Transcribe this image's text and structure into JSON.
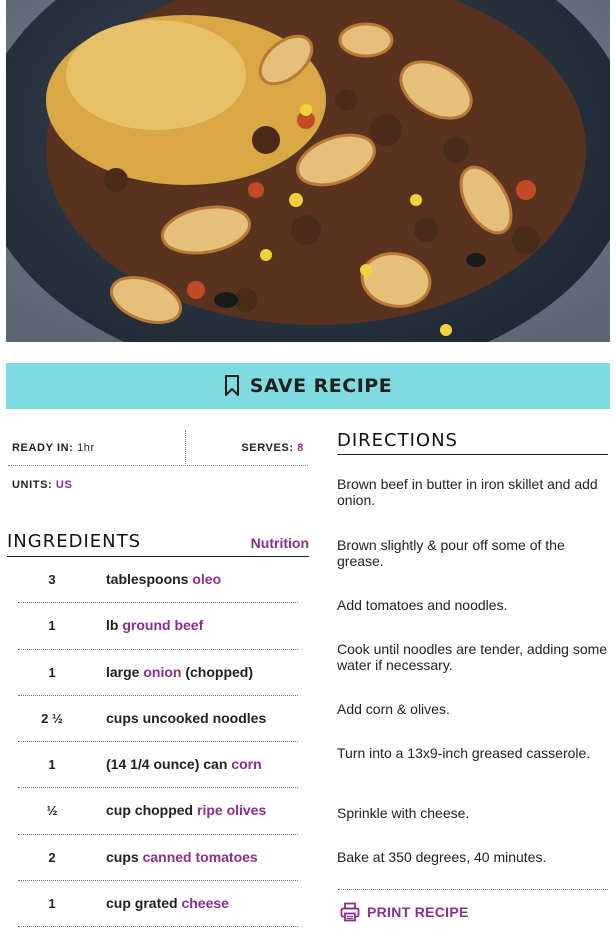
{
  "photo": {
    "alt_icon": "casserole-photo"
  },
  "save_recipe": {
    "label": "SAVE RECIPE",
    "icon": "bookmark-icon"
  },
  "meta": {
    "ready_label": "READY IN:",
    "ready_value": "1hr",
    "serves_label": "SERVES:",
    "serves_value": "8",
    "units_label": "UNITS:",
    "units_value": "US"
  },
  "ingredients": {
    "title": "INGREDIENTS",
    "nutrition_link": "Nutrition",
    "items": [
      {
        "qty": "3",
        "pre": "tablespoons ",
        "link": "oleo",
        "post": ""
      },
      {
        "qty": "1",
        "pre": "lb ",
        "link": "ground beef",
        "post": ""
      },
      {
        "qty": "1",
        "pre": "large ",
        "link": "onion",
        "post": " (chopped)"
      },
      {
        "qty": "2 ½",
        "pre": "cups uncooked noodles",
        "link": "",
        "post": ""
      },
      {
        "qty": "1",
        "pre": "(14 1/4 ounce) can ",
        "link": "corn",
        "post": ""
      },
      {
        "qty": "½",
        "pre": "cup chopped ",
        "link": "ripe olives",
        "post": ""
      },
      {
        "qty": "2",
        "pre": "cups ",
        "link": "canned tomatoes",
        "post": ""
      },
      {
        "qty": "1",
        "pre": "cup grated ",
        "link": "cheese",
        "post": ""
      }
    ]
  },
  "directions": {
    "title": "DIRECTIONS",
    "steps": [
      "Brown beef in butter in iron skillet and add onion.",
      "Brown slightly & pour off some of the grease.",
      "Add tomatoes and noodles.",
      "Cook until noodles are tender, adding some water if necessary.",
      "Add corn & olives.",
      "Turn into a 13x9-inch greased casserole.",
      "Sprinkle with cheese.",
      "Bake at 350 degrees, 40 minutes."
    ]
  },
  "print": {
    "label": "PRINT RECIPE",
    "icon": "printer-icon"
  },
  "colors": {
    "accent": "#8b2f8c",
    "save_bar": "#7fdbe0"
  }
}
